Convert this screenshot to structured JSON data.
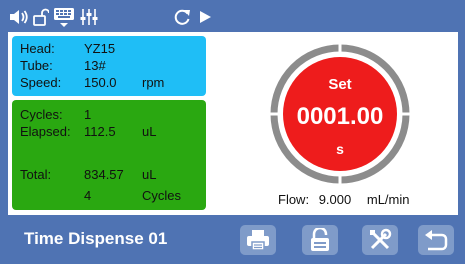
{
  "info": {
    "head_label": "Head:",
    "head_value": "YZ15",
    "tube_label": "Tube:",
    "tube_value": "13#",
    "speed_label": "Speed:",
    "speed_value": "150.0",
    "speed_unit": "rpm"
  },
  "stats": {
    "cycles_label": "Cycles:",
    "cycles_value": "1",
    "elapsed_label": "Elapsed:",
    "elapsed_value": "112.5",
    "elapsed_unit": "uL",
    "total_label": "Total:",
    "total_value": "834.57",
    "total_unit": "uL",
    "total_cycles_value": "4",
    "total_cycles_unit": "Cycles"
  },
  "dial": {
    "label": "Set",
    "value": "0001.00",
    "unit": "s"
  },
  "flow": {
    "label": "Flow:",
    "value": "9.000",
    "unit": "mL/min"
  },
  "footer": {
    "title": "Time Dispense 01"
  },
  "icons": [
    "speaker-icon",
    "unlock-icon",
    "keyboard-icon",
    "sliders-icon",
    "refresh-icon",
    "play-icon",
    "print-icon",
    "lock-icon",
    "tools-icon",
    "back-icon"
  ],
  "colors": {
    "background": "#4f73b3",
    "info_panel": "#1fbef6",
    "stats_panel": "#2aa811",
    "dial_ring": "#8c8c8c",
    "dial_center": "#ee1c1c",
    "button": "#7f9bc9"
  }
}
